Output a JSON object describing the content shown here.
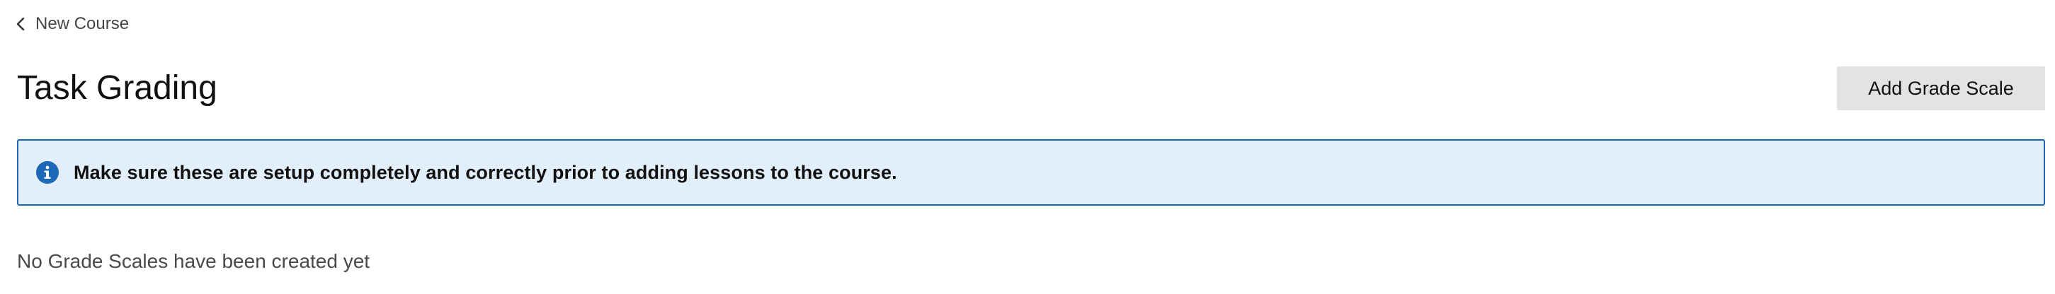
{
  "breadcrumb": {
    "back_label": "New Course",
    "icon": "chevron-left-icon"
  },
  "header": {
    "title": "Task Grading",
    "add_button_label": "Add Grade Scale"
  },
  "info_banner": {
    "icon": "info-icon",
    "message": "Make sure these are setup completely and correctly prior to adding lessons to the course.",
    "background_color": "#e2eef9",
    "border_color": "#1b68b6",
    "icon_color": "#1b68b6"
  },
  "content": {
    "empty_message": "No Grade Scales have been created yet"
  }
}
